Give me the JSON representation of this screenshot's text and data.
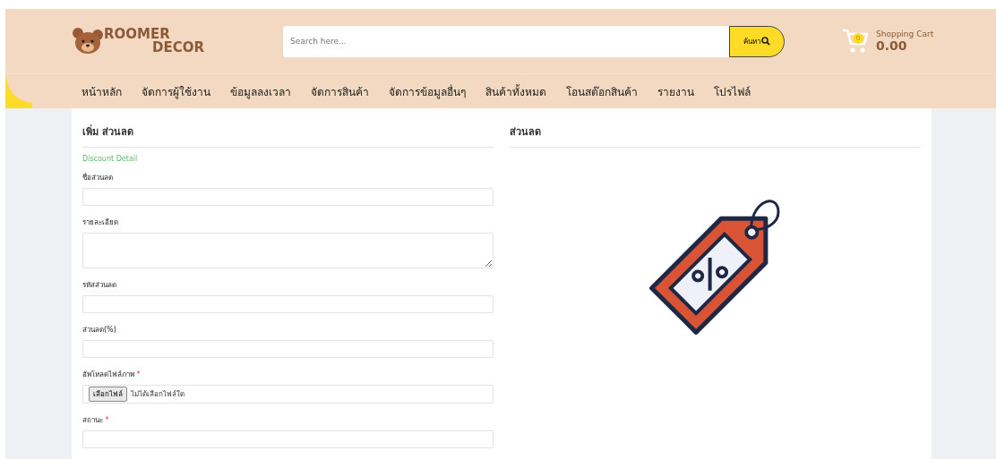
{
  "logo": {
    "line_1": "ROOMER",
    "line_2": "DECOR"
  },
  "search": {
    "placeholder": "Search here...",
    "button": "ค้นหา"
  },
  "cart": {
    "count": "0",
    "label": "Shopping Cart",
    "total": "0.00"
  },
  "nav": [
    "หน้าหลัก",
    "จัดการผู้ใช้งาน",
    "ข้อมูลลงเวลา",
    "จัดการสินค้า",
    "จัดการข้อมูลอื่นๆ",
    "สินค้าทั้งหมด",
    "โอนสต๊อกสินค้า",
    "รายงาน",
    "โปรไฟล์"
  ],
  "form": {
    "title": "เพิ่ม ส่วนลด",
    "subtitle": "Discount Detail",
    "fields": [
      {
        "kind": "text",
        "label": "ชื่อส่วนลด"
      },
      {
        "kind": "textarea",
        "label": "รายละเอียด"
      },
      {
        "kind": "text",
        "label": "รหัสส่วนลด"
      },
      {
        "kind": "text",
        "label": "ส่วนลด(%)"
      },
      {
        "kind": "file",
        "label": "อัพโหลดไฟล์ภาพ",
        "required_mark": "*",
        "button": "เลือกไฟล์",
        "value": "ไม่ได้เลือกไฟล์ใด"
      },
      {
        "kind": "select",
        "label": "สถานะ",
        "required_mark": "*"
      }
    ]
  },
  "preview": {
    "title": "ส่วนลด"
  }
}
